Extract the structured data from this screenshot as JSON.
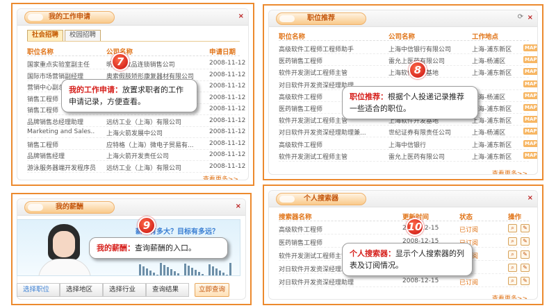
{
  "colors": {
    "frame": "#ec8a2e",
    "accent": "#e0751a",
    "callout_title": "#d6201c"
  },
  "apps": {
    "title": "我的工作申请",
    "subtabs": [
      "社会招聘",
      "校园招聘"
    ],
    "headers": [
      "职位名称",
      "公司名称",
      "申请日期"
    ],
    "rows": [
      [
        "国家重点实验室副主任",
        "明...化妆品连锁销售公司",
        "2008-11-12"
      ],
      [
        "国际市场营销副经理",
        "奥索假肢矫形康复器材有限公司",
        "2008-11-12"
      ],
      [
        "营销中心副总",
        "",
        "2008-11-12"
      ],
      [
        "销售工程师",
        "",
        "2008-11-12"
      ],
      [
        "销售工程师",
        "",
        "2008-11-12"
      ],
      [
        "品牌销售总经理助理",
        "远纺工业（上海）有限公司",
        "2008-11-12"
      ],
      [
        "Marketing and Sales..",
        "上海火箭发展中公司",
        "2008-11-12"
      ],
      [
        "销售工程师",
        "应特格（上海）微电子贸易有...",
        "2008-11-12"
      ],
      [
        "品牌销售经理",
        "上海火箭开发责任公司",
        "2008-11-12"
      ],
      [
        "游泳服务器端开发程序员",
        "远纺工业（上海）有限公司",
        "2008-11-12"
      ]
    ],
    "more": "查看更多>>",
    "close": "×",
    "callout_title": "我的工作申请：",
    "callout_text": "放置求职者的工作申请记录，方便查看。",
    "badge": "7"
  },
  "recommend": {
    "title": "职位推荐",
    "headers": [
      "职位名称",
      "公司名称",
      "工作地点"
    ],
    "map_label": "MAP",
    "rows": [
      [
        "高级软件工程师工程师助手",
        "上海中信银行有限公司",
        "上海-浦东新区"
      ],
      [
        "医药销售工程师",
        "雷允上医药有限公司",
        "上海-杨浦区"
      ],
      [
        "软件开发测试工程师主管",
        "上海软件开发基地",
        "上海-浦东新区"
      ],
      [
        "对日软件开发资深经理助理",
        "",
        ""
      ],
      [
        "高级软件工程师",
        "",
        "上海-杨浦区"
      ],
      [
        "医药销售工程师",
        "",
        "上海-浦东新区"
      ],
      [
        "软件开发测试工程师主管",
        "上海软件开发基地",
        "上海-浦东新区"
      ],
      [
        "对日软件开发资深经理助理兼...",
        "世纪证券有限责任公司",
        "上海-杨浦区"
      ],
      [
        "高级软件工程师",
        "上海中信银行",
        "上海-浦东新区"
      ],
      [
        "软件开发测试工程师主管",
        "雷允上医药有限公司",
        "上海-浦东新区"
      ]
    ],
    "more": "查看更多>>",
    "close": "×",
    "refresh": "⟳",
    "callout_title": "职位推荐：",
    "callout_text": "根据个人投递记录推荐一些适合的职位。",
    "badge": "8"
  },
  "salary": {
    "title": "我的薪酬",
    "question": "薪水有多大？目标有多远？",
    "sub_question": "...  ...",
    "steps": [
      "选择职位",
      "选择地区",
      "选择行业",
      "查询结果"
    ],
    "query_button": "立即查询",
    "close": "×",
    "callout_title": "我的薪酬：",
    "callout_text": "查询薪酬的入口。",
    "badge": "9"
  },
  "agents": {
    "title": "个人搜索器",
    "headers": [
      "搜索器名称",
      "更新时间",
      "状态",
      "操作"
    ],
    "rows": [
      [
        "高级软件工程师",
        "2008-12-15",
        "已订阅"
      ],
      [
        "医药销售工程师",
        "2008-12-15",
        "已订阅"
      ],
      [
        "软件开发测试工程师主管",
        "",
        "已订阅"
      ],
      [
        "对日软件开发资深经理助理",
        "",
        ""
      ],
      [
        "对日软件开发资深经理助理",
        "2008-12-15",
        "已订阅"
      ]
    ],
    "more": "查看更多>>",
    "close": "×",
    "callout_title": "个人搜索器：",
    "callout_text": "显示个人搜索器的列表及订阅情况。",
    "badge": "10"
  }
}
